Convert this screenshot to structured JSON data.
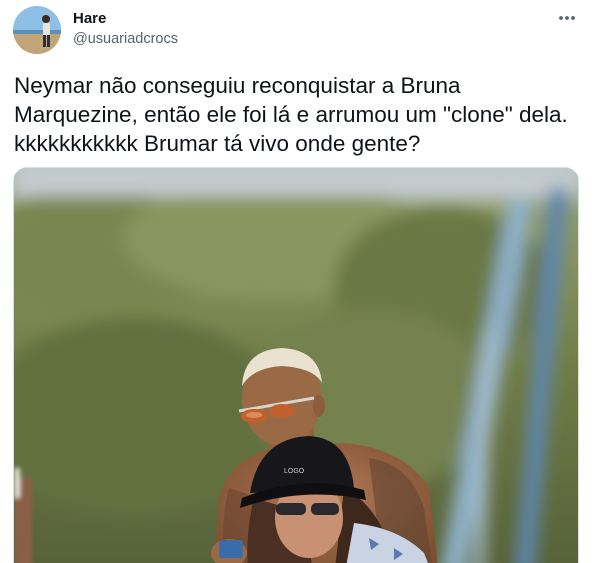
{
  "user": {
    "display_name": "Hare",
    "handle": "@usuariadcrocs",
    "avatar_icon": "profile-photo-beach"
  },
  "actions": {
    "more_icon": "more-horizontal-icon"
  },
  "tweet": {
    "text": "Neymar não conseguiu reconquistar a Bruna\nMarquezine, então ele foi lá e arrumou um \"clone\" dela.\nkkkkkkkkkkk Brumar tá vivo onde gente?"
  },
  "media": {
    "type": "photo",
    "cap_text": "LOGO",
    "colors": {
      "foliage": "#6f7c48",
      "sky": "#b9c6cf",
      "pole": "#6f93b5"
    }
  }
}
